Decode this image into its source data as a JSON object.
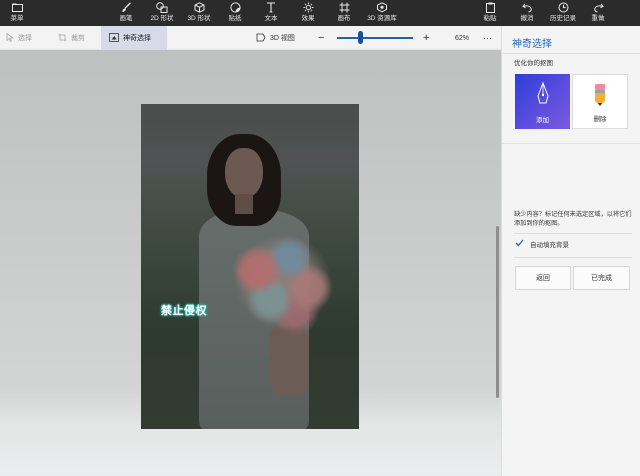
{
  "ribbon": {
    "menu": "菜单",
    "brush": "画笔",
    "shapes2d": "2D 形状",
    "shapes3d": "3D 形状",
    "sticker": "贴纸",
    "text": "文本",
    "effects": "效果",
    "canvas": "画布",
    "library3d": "3D 资源库",
    "paste": "粘贴",
    "undo": "撤消",
    "history": "历史记录",
    "redo": "重做"
  },
  "subbar": {
    "select": "选择",
    "crop": "裁剪",
    "magic_select": "神奇选择",
    "view3d": "3D 视图",
    "zoom_level": "62%",
    "zoom_slider_fraction": 0.3
  },
  "canvas": {
    "watermark": "禁止侵权"
  },
  "panel": {
    "title": "神奇选择",
    "subtitle": "优化你的抠图",
    "add_label": "添加",
    "remove_label": "删除",
    "note": "缺少内容？标记任何未选定区域，以将它们添加到你的抠图。",
    "autofill_label": "自动填充背景",
    "autofill_checked": true,
    "back_button": "返回",
    "done_button": "已完成"
  },
  "colors": {
    "accent": "#2867b3",
    "ribbon_bg": "#2b2b2b",
    "watermark_glow": "#28d0c2"
  }
}
